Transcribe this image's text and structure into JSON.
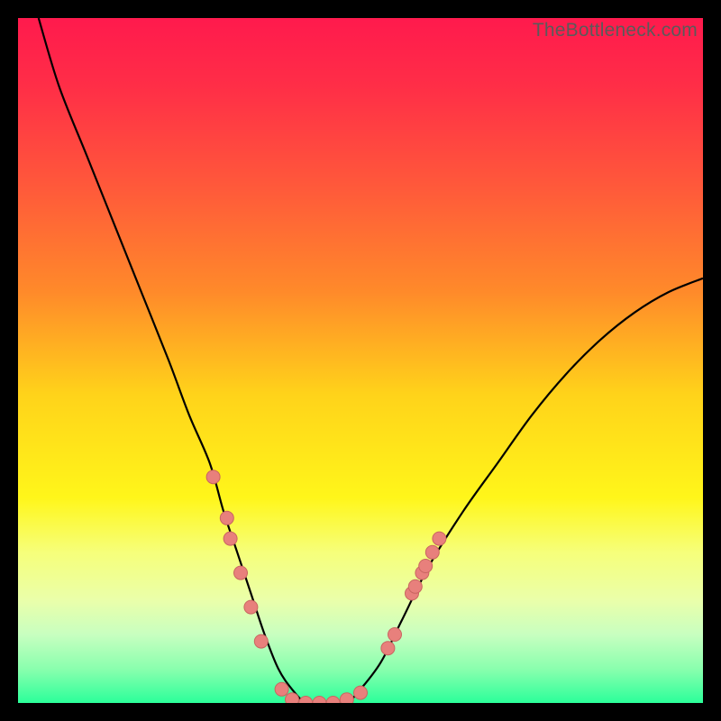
{
  "watermark": "TheBottleneck.com",
  "colors": {
    "gradient_stops": [
      {
        "offset": 0.0,
        "color": "#ff1a4d"
      },
      {
        "offset": 0.1,
        "color": "#ff2e47"
      },
      {
        "offset": 0.25,
        "color": "#ff5a3a"
      },
      {
        "offset": 0.4,
        "color": "#ff8a2a"
      },
      {
        "offset": 0.55,
        "color": "#ffd31a"
      },
      {
        "offset": 0.7,
        "color": "#fff61a"
      },
      {
        "offset": 0.78,
        "color": "#f6ff7a"
      },
      {
        "offset": 0.85,
        "color": "#eaffaa"
      },
      {
        "offset": 0.9,
        "color": "#c8ffc0"
      },
      {
        "offset": 0.95,
        "color": "#8affae"
      },
      {
        "offset": 1.0,
        "color": "#2bff9a"
      }
    ],
    "curve": "#000000",
    "dot_fill": "#e8807c",
    "dot_stroke": "#c96560"
  },
  "chart_data": {
    "type": "line",
    "title": "",
    "xlabel": "",
    "ylabel": "",
    "xlim": [
      0,
      100
    ],
    "ylim": [
      0,
      100
    ],
    "series": [
      {
        "name": "bottleneck-curve",
        "x": [
          3,
          6,
          10,
          14,
          18,
          22,
          25,
          28,
          30,
          32,
          34,
          36,
          38,
          40,
          42,
          44,
          46,
          48,
          50,
          53,
          56,
          60,
          65,
          70,
          75,
          80,
          85,
          90,
          95,
          100
        ],
        "y": [
          100,
          90,
          80,
          70,
          60,
          50,
          42,
          35,
          28,
          22,
          16,
          10,
          5,
          2,
          0,
          0,
          0,
          0,
          2,
          6,
          12,
          20,
          28,
          35,
          42,
          48,
          53,
          57,
          60,
          62
        ]
      }
    ],
    "markers": {
      "name": "highlight-dots",
      "points": [
        {
          "x": 28.5,
          "y": 33
        },
        {
          "x": 30.5,
          "y": 27
        },
        {
          "x": 31.0,
          "y": 24
        },
        {
          "x": 32.5,
          "y": 19
        },
        {
          "x": 34.0,
          "y": 14
        },
        {
          "x": 35.5,
          "y": 9
        },
        {
          "x": 38.5,
          "y": 2
        },
        {
          "x": 40.0,
          "y": 0.5
        },
        {
          "x": 42.0,
          "y": 0
        },
        {
          "x": 44.0,
          "y": 0
        },
        {
          "x": 46.0,
          "y": 0
        },
        {
          "x": 48.0,
          "y": 0.5
        },
        {
          "x": 50.0,
          "y": 1.5
        },
        {
          "x": 54.0,
          "y": 8
        },
        {
          "x": 55.0,
          "y": 10
        },
        {
          "x": 57.5,
          "y": 16
        },
        {
          "x": 58.0,
          "y": 17
        },
        {
          "x": 59.0,
          "y": 19
        },
        {
          "x": 59.5,
          "y": 20
        },
        {
          "x": 60.5,
          "y": 22
        },
        {
          "x": 61.5,
          "y": 24
        }
      ]
    }
  }
}
